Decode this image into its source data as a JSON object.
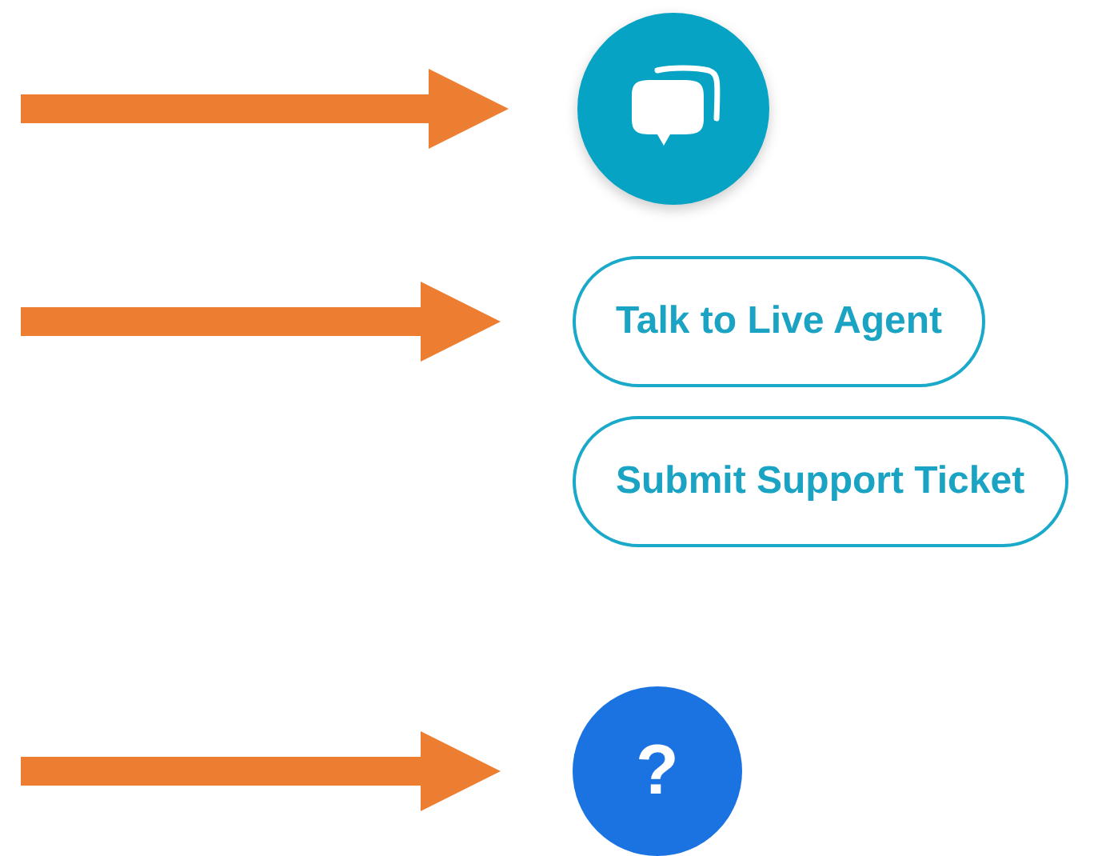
{
  "items": [
    {
      "kind": "chat-launcher",
      "arrow": true
    },
    {
      "kind": "option",
      "label": "Talk to Live Agent",
      "arrow": true
    },
    {
      "kind": "option",
      "label": "Submit Support Ticket",
      "arrow": false
    },
    {
      "kind": "help-launcher",
      "label": "?",
      "arrow": true
    }
  ]
}
